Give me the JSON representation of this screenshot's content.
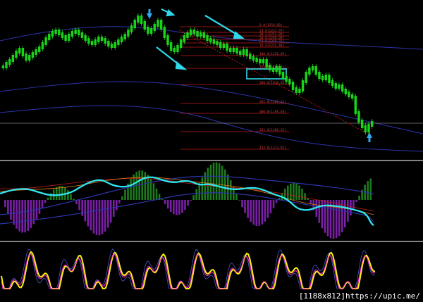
{
  "watermark": "[1188x812]https://upic.me/",
  "colors": {
    "background": "#000000",
    "candle": "#19d219",
    "fib_line": "#c01c1c",
    "fib_text": "#d23c3c",
    "arrow": "#2fd7e8",
    "cyan_line": "#2fe6f0",
    "histogram_up": "#1d7a1d",
    "histogram_down": "#7a1fa6",
    "stoch_main": "#ffee11",
    "stoch_signal": "#ff2fd4",
    "envelope": "#2c35a8",
    "separator": "#b0b0b0"
  },
  "fib_levels": [
    {
      "label": "0.0(1258.68)"
    },
    {
      "label": "23.6(1253.97)"
    },
    {
      "label": "38.2(1251.05)"
    },
    {
      "label": "50.0(1248.69)"
    },
    {
      "label": "61.8(1246.32)"
    },
    {
      "label": "76.4(1243.40)"
    },
    {
      "label": "100.0(1238.69)"
    },
    {
      "label": "161.8(1226.31)"
    },
    {
      "label": "200.0(1218.68)"
    },
    {
      "label": "261.8(1206.32)"
    },
    {
      "label": "300.0(1198.68)"
    },
    {
      "label": "361.8(1186.32)"
    },
    {
      "label": "423.6(1173.95)"
    }
  ]
}
